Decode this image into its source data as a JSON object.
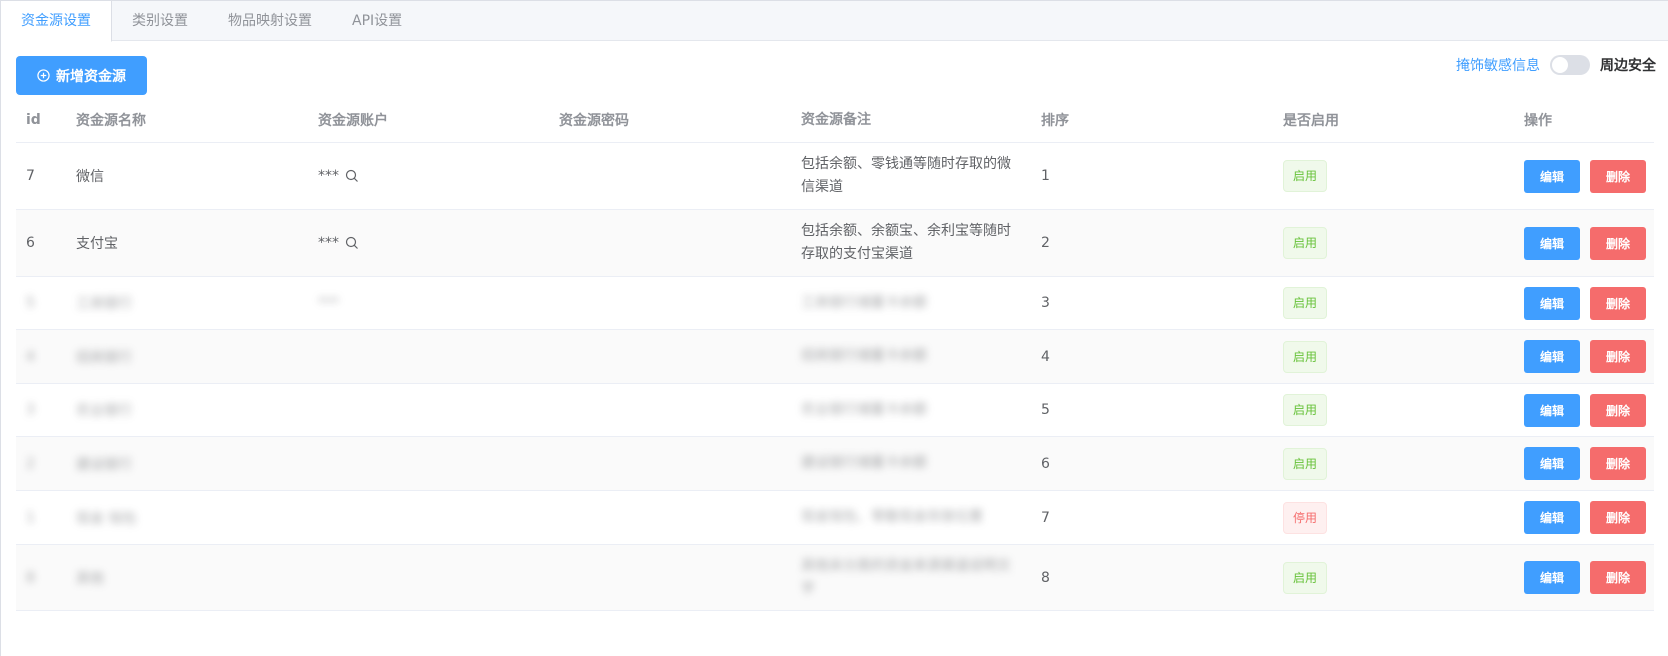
{
  "tabs": [
    {
      "label": "资金源设置",
      "active": true
    },
    {
      "label": "类别设置",
      "active": false
    },
    {
      "label": "物品映射设置",
      "active": false
    },
    {
      "label": "API设置",
      "active": false
    }
  ],
  "toolbar": {
    "add_label": "新增资金源",
    "mask_label": "掩饰敏感信息",
    "mask_switch_on": false,
    "periph_label": "周边安全"
  },
  "table": {
    "headers": [
      "id",
      "资金源名称",
      "资金源账户",
      "资金源密码",
      "资金源备注",
      "排序",
      "是否启用",
      "操作"
    ],
    "edit_label": "编辑",
    "delete_label": "删除",
    "rows": [
      {
        "id": "7",
        "name": "微信",
        "account": "***",
        "password": "",
        "note": "包括余额、零钱通等随时存取的微信渠道",
        "sort": "1",
        "status": "启用",
        "enabled": true,
        "blurred": false
      },
      {
        "id": "6",
        "name": "支付宝",
        "account": "***",
        "password": "",
        "note": "包括余额、余额宝、余利宝等随时存取的支付宝渠道",
        "sort": "2",
        "status": "启用",
        "enabled": true,
        "blurred": false
      },
      {
        "id": "5",
        "name": "工商银行",
        "account": "***",
        "password": "",
        "note": "工商银行储蓄卡余额",
        "sort": "3",
        "status": "启用",
        "enabled": true,
        "blurred": true
      },
      {
        "id": "4",
        "name": "招商银行",
        "account": "",
        "password": "",
        "note": "招商银行储蓄卡余额",
        "sort": "4",
        "status": "启用",
        "enabled": true,
        "blurred": true
      },
      {
        "id": "3",
        "name": "农业银行",
        "account": "",
        "password": "",
        "note": "农业银行储蓄卡余额",
        "sort": "5",
        "status": "启用",
        "enabled": true,
        "blurred": true
      },
      {
        "id": "2",
        "name": "建设银行",
        "account": "",
        "password": "",
        "note": "建设银行储蓄卡余额",
        "sort": "6",
        "status": "启用",
        "enabled": true,
        "blurred": true
      },
      {
        "id": "1",
        "name": "现金 钱包",
        "account": "",
        "password": "",
        "note": "现金钱包、零散现金存放位置",
        "sort": "7",
        "status": "停用",
        "enabled": false,
        "blurred": true
      },
      {
        "id": "8",
        "name": "其他",
        "account": "",
        "password": "",
        "note": "其他未分类的资金来源渠道说明文字",
        "sort": "8",
        "status": "启用",
        "enabled": true,
        "blurred": true
      }
    ]
  },
  "colors": {
    "primary": "#409eff",
    "danger": "#f56c6c",
    "success": "#67c23a"
  },
  "icons": {
    "add": "circle-plus-icon",
    "reveal": "search-icon"
  }
}
